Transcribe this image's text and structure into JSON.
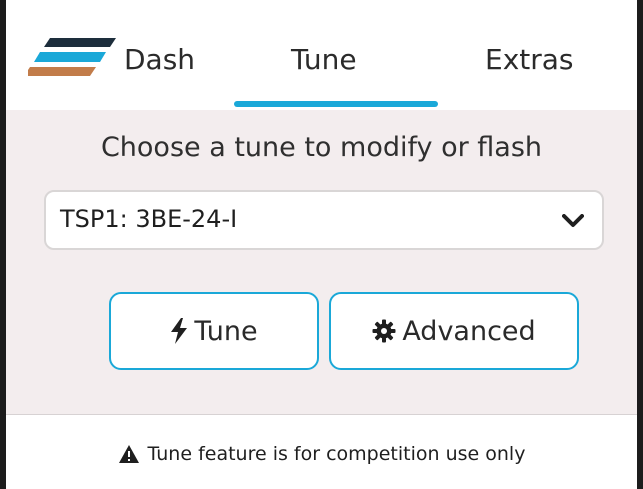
{
  "nav": {
    "items": [
      {
        "label": "Dash"
      },
      {
        "label": "Tune"
      },
      {
        "label": "Extras"
      }
    ],
    "active": "Tune",
    "accent": "#1aa8d8",
    "logo_colors": [
      "#1d2e3c",
      "#1aa8d8",
      "#c27c4a"
    ]
  },
  "main": {
    "prompt": "Choose a tune to modify or flash",
    "tune_select": {
      "value": "TSP1: 3BE-24-I"
    },
    "buttons": {
      "tune": {
        "label": "Tune",
        "icon": "bolt-icon"
      },
      "advanced": {
        "label": "Advanced",
        "icon": "gear-icon"
      }
    }
  },
  "footer": {
    "warning": "Tune feature is for competition use only",
    "icon": "warning-icon"
  }
}
